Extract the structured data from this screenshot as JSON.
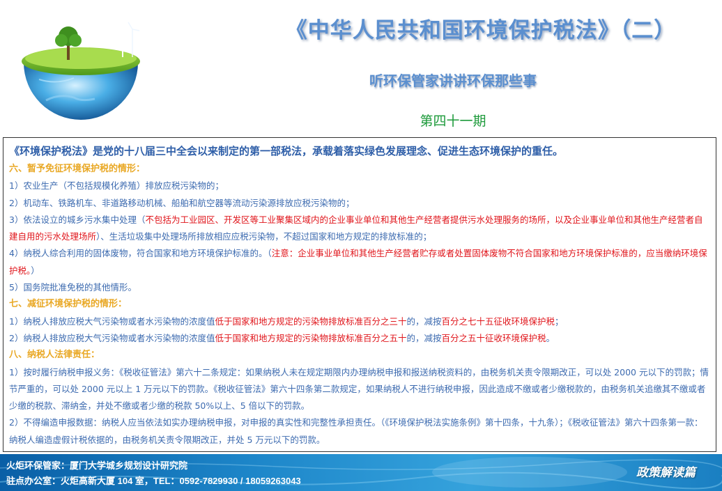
{
  "header": {
    "title": "《中华人民共和国环境保护税法》（二）",
    "subtitle": "听环保管家讲讲环保那些事",
    "issue": "第四十一期"
  },
  "content": {
    "lead": "《环境保护税法》是党的十八届三中全会以来制定的第一部税法，承载着落实绿色发展理念、促进生态环境保护的重任。",
    "s6": {
      "heading": "六、暂予免征环境保护税的情形：",
      "item1": "1）农业生产（不包括规模化养殖）排放应税污染物的；",
      "item2": "2）机动车、铁路机车、非道路移动机械、船舶和航空器等流动污染源排放应税污染物的；",
      "item3_a": "3）依法设立的城乡污水集中处理（",
      "item3_red": "不包括为工业园区、开发区等工业聚集区域内的企业事业单位和其他生产经营者提供污水处理服务的场所，以及企业事业单位和其他生产经营者自建自用的污水处理场所",
      "item3_b": "）、生活垃圾集中处理场所排放相应应税污染物，不超过国家和地方规定的排放标准的；",
      "item4_a": "4）纳税人综合利用的固体废物，符合国家和地方环境保护标准的。（",
      "item4_red": "注意：企业事业单位和其他生产经营者贮存或者处置固体废物不符合国家和地方环境保护标准的，应当缴纳环境保护税。",
      "item4_b": "）",
      "item5": "5）国务院批准免税的其他情形。"
    },
    "s7": {
      "heading": "七、减征环境保护税的情形：",
      "item1_a": "1）纳税人排放应税大气污染物或者水污染物的浓度值",
      "item1_red1": "低于国家和地方规定的污染物排放标准百分之三十",
      "item1_b": "的，减按",
      "item1_red2": "百分之七十五征收环境保护税",
      "item1_c": "；",
      "item2_a": "2）纳税人排放应税大气污染物或者水污染物的浓度值",
      "item2_red1": "低于国家和地方规定的污染物排放标准百分之五十",
      "item2_b": "的，减按",
      "item2_red2": "百分之五十征收环境保护税",
      "item2_c": "。"
    },
    "s8": {
      "heading": "八、纳税人法律责任：",
      "item1": "1）按时履行纳税申报义务：《税收征管法》第六十二条规定：如果纳税人未在规定期限内办理纳税申报和报送纳税资料的，由税务机关责令限期改正，可以处 2000 元以下的罚款；情节严重的，可以处 2000 元以上 1 万元以下的罚款。《税收征管法》第六十四条第二款规定，如果纳税人不进行纳税申报，因此造成不缴或者少缴税款的，由税务机关追缴其不缴或者少缴的税款、滞纳金，并处不缴或者少缴的税款 50%以上、5 倍以下的罚款。",
      "item2": "2）不得编造申报数据：纳税人应当依法如实办理纳税申报，对申报的真实性和完整性承担责任。（《环境保护税法实施条例》第十四条，十九条）；《税收征管法》第六十四条第一款：纳税人编造虚假计税依据的，由税务机关责令限期改正，并处 5 万元以下的罚款。"
    }
  },
  "footer": {
    "line1": "火炬环保管家：厦门大学城乡规划设计研究院",
    "line2": "驻点办公室：火炬高新大厦 104 室，TEL：0592-7829930 / 18059263043",
    "tag": "政策解读篇"
  }
}
